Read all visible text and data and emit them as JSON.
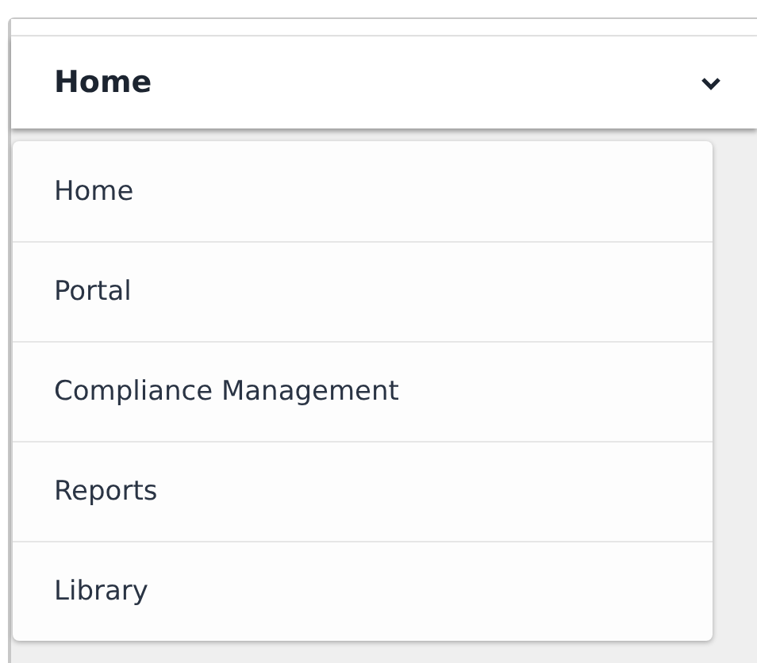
{
  "header": {
    "title": "Home",
    "expanded": true
  },
  "menu": {
    "items": [
      {
        "label": "Home"
      },
      {
        "label": "Portal"
      },
      {
        "label": "Compliance Management"
      },
      {
        "label": "Reports"
      },
      {
        "label": "Library"
      }
    ]
  }
}
